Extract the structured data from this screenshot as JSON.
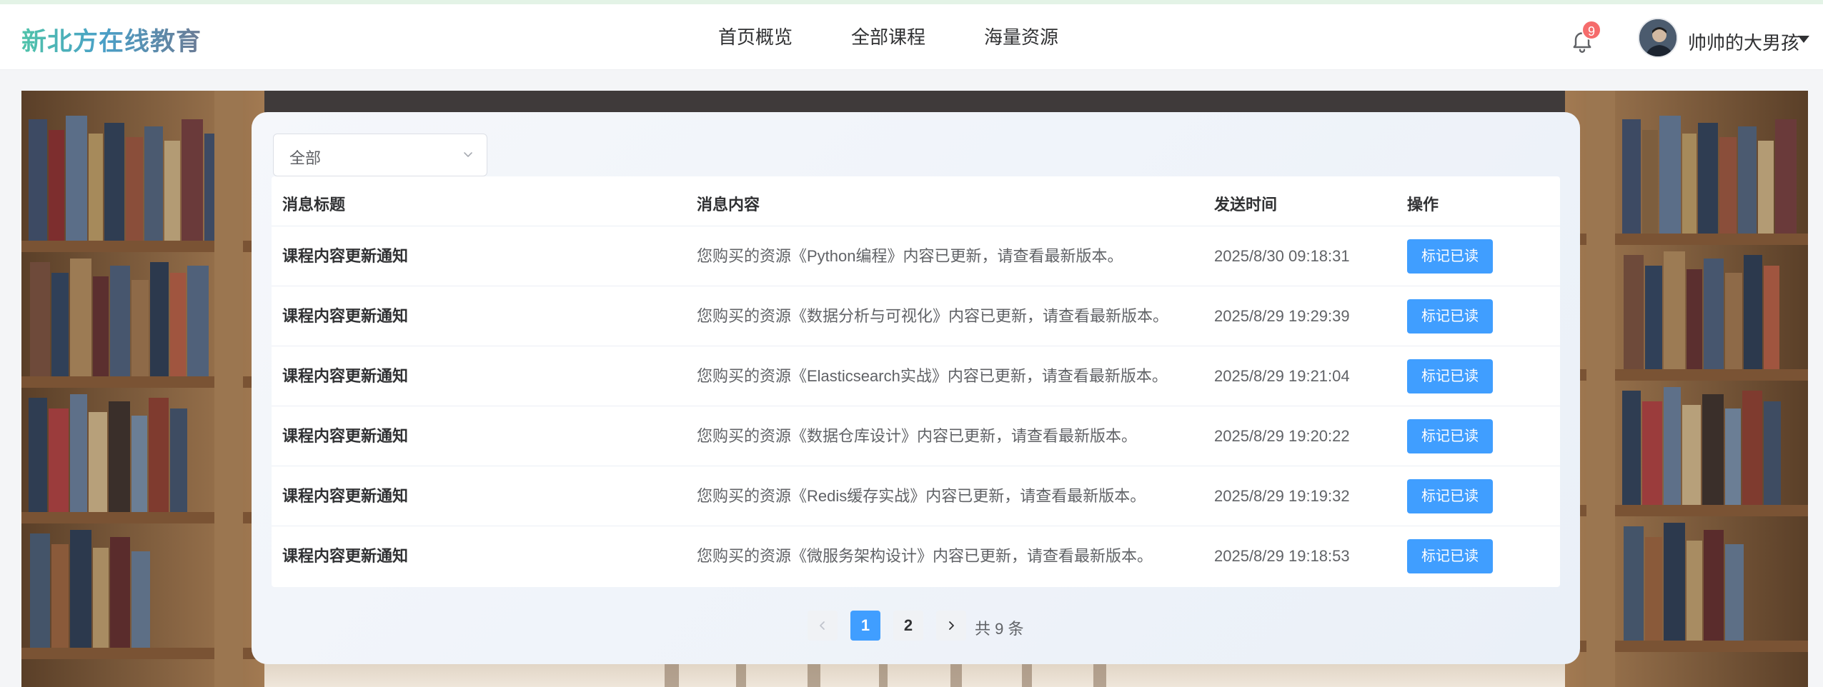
{
  "header": {
    "logo": "新北方在线教育",
    "nav": [
      "首页概览",
      "全部课程",
      "海量资源"
    ],
    "notification_count": "9",
    "username": "帅帅的大男孩"
  },
  "filter": {
    "value": "全部"
  },
  "table": {
    "columns": [
      "消息标题",
      "消息内容",
      "发送时间",
      "操作"
    ],
    "rows": [
      {
        "title": "课程内容更新通知",
        "content": "您购买的资源《Python编程》内容已更新，请查看最新版本。",
        "time": "2025/8/30 09:18:31",
        "action": "标记已读"
      },
      {
        "title": "课程内容更新通知",
        "content": "您购买的资源《数据分析与可视化》内容已更新，请查看最新版本。",
        "time": "2025/8/29 19:29:39",
        "action": "标记已读"
      },
      {
        "title": "课程内容更新通知",
        "content": "您购买的资源《Elasticsearch实战》内容已更新，请查看最新版本。",
        "time": "2025/8/29 19:21:04",
        "action": "标记已读"
      },
      {
        "title": "课程内容更新通知",
        "content": "您购买的资源《数据仓库设计》内容已更新，请查看最新版本。",
        "time": "2025/8/29 19:20:22",
        "action": "标记已读"
      },
      {
        "title": "课程内容更新通知",
        "content": "您购买的资源《Redis缓存实战》内容已更新，请查看最新版本。",
        "time": "2025/8/29 19:19:32",
        "action": "标记已读"
      },
      {
        "title": "课程内容更新通知",
        "content": "您购买的资源《微服务架构设计》内容已更新，请查看最新版本。",
        "time": "2025/8/29 19:18:53",
        "action": "标记已读"
      }
    ]
  },
  "pagination": {
    "pages": [
      "1",
      "2"
    ],
    "current": "1",
    "total_text": "共 9 条"
  },
  "colors": {
    "primary": "#409eff",
    "badge": "#f56c6c"
  },
  "icons": {
    "bell": "bell-icon",
    "caret": "caret-down-icon",
    "prev": "chevron-left-icon",
    "next": "chevron-right-icon"
  }
}
